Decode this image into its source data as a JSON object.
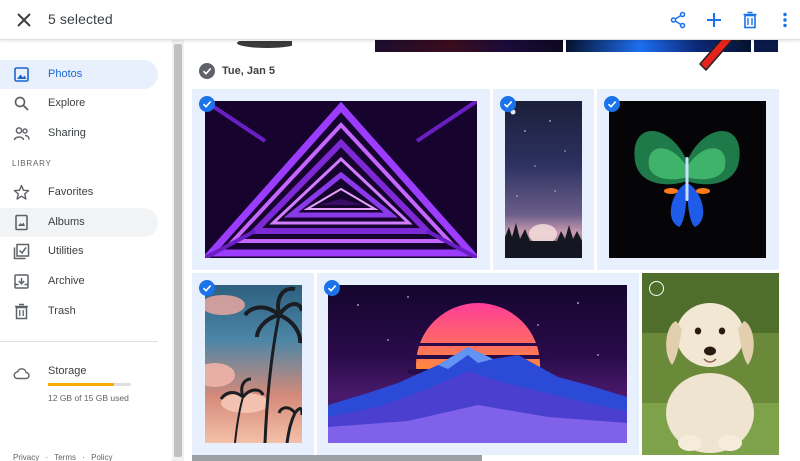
{
  "header": {
    "selected_text": "5 selected",
    "icons": [
      "close-icon",
      "share-icon",
      "add-icon",
      "trash-icon",
      "more-vert-icon"
    ]
  },
  "sidebar": {
    "items": [
      {
        "label": "Photos",
        "icon": "photos-icon",
        "state": "active"
      },
      {
        "label": "Explore",
        "icon": "search-icon"
      },
      {
        "label": "Sharing",
        "icon": "people-icon"
      },
      {
        "label": "Favorites",
        "icon": "star-icon"
      },
      {
        "label": "Albums",
        "icon": "album-icon",
        "state": "hovered"
      },
      {
        "label": "Utilities",
        "icon": "utilities-icon"
      },
      {
        "label": "Archive",
        "icon": "archive-icon"
      },
      {
        "label": "Trash",
        "icon": "trash-icon"
      }
    ],
    "library_label": "LIBRARY",
    "storage": {
      "label": "Storage",
      "used_text": "12 GB of 15 GB used",
      "fraction_used": 0.8
    },
    "footer_links": [
      "Privacy",
      "·",
      "Terms",
      "·",
      "Policy"
    ]
  },
  "main": {
    "date_label": "Tue, Jan 5",
    "photos": [
      {
        "name": "purple-neon-triangle-tunnel",
        "selected": true
      },
      {
        "name": "night-sky-moon-forest",
        "selected": true
      },
      {
        "name": "neon-butterfly",
        "selected": true
      },
      {
        "name": "palm-trees-pink-clouds",
        "selected": true
      },
      {
        "name": "synthwave-sunset-mountains",
        "selected": true
      },
      {
        "name": "labrador-puppy",
        "selected": false
      }
    ]
  },
  "annotation": {
    "arrow_color": "#e8231b",
    "points_to": "trash-icon"
  },
  "colors": {
    "accent": "#1a73e8",
    "active_nav_bg": "#e8f0fe",
    "storage_fill": "#f9ab00"
  }
}
